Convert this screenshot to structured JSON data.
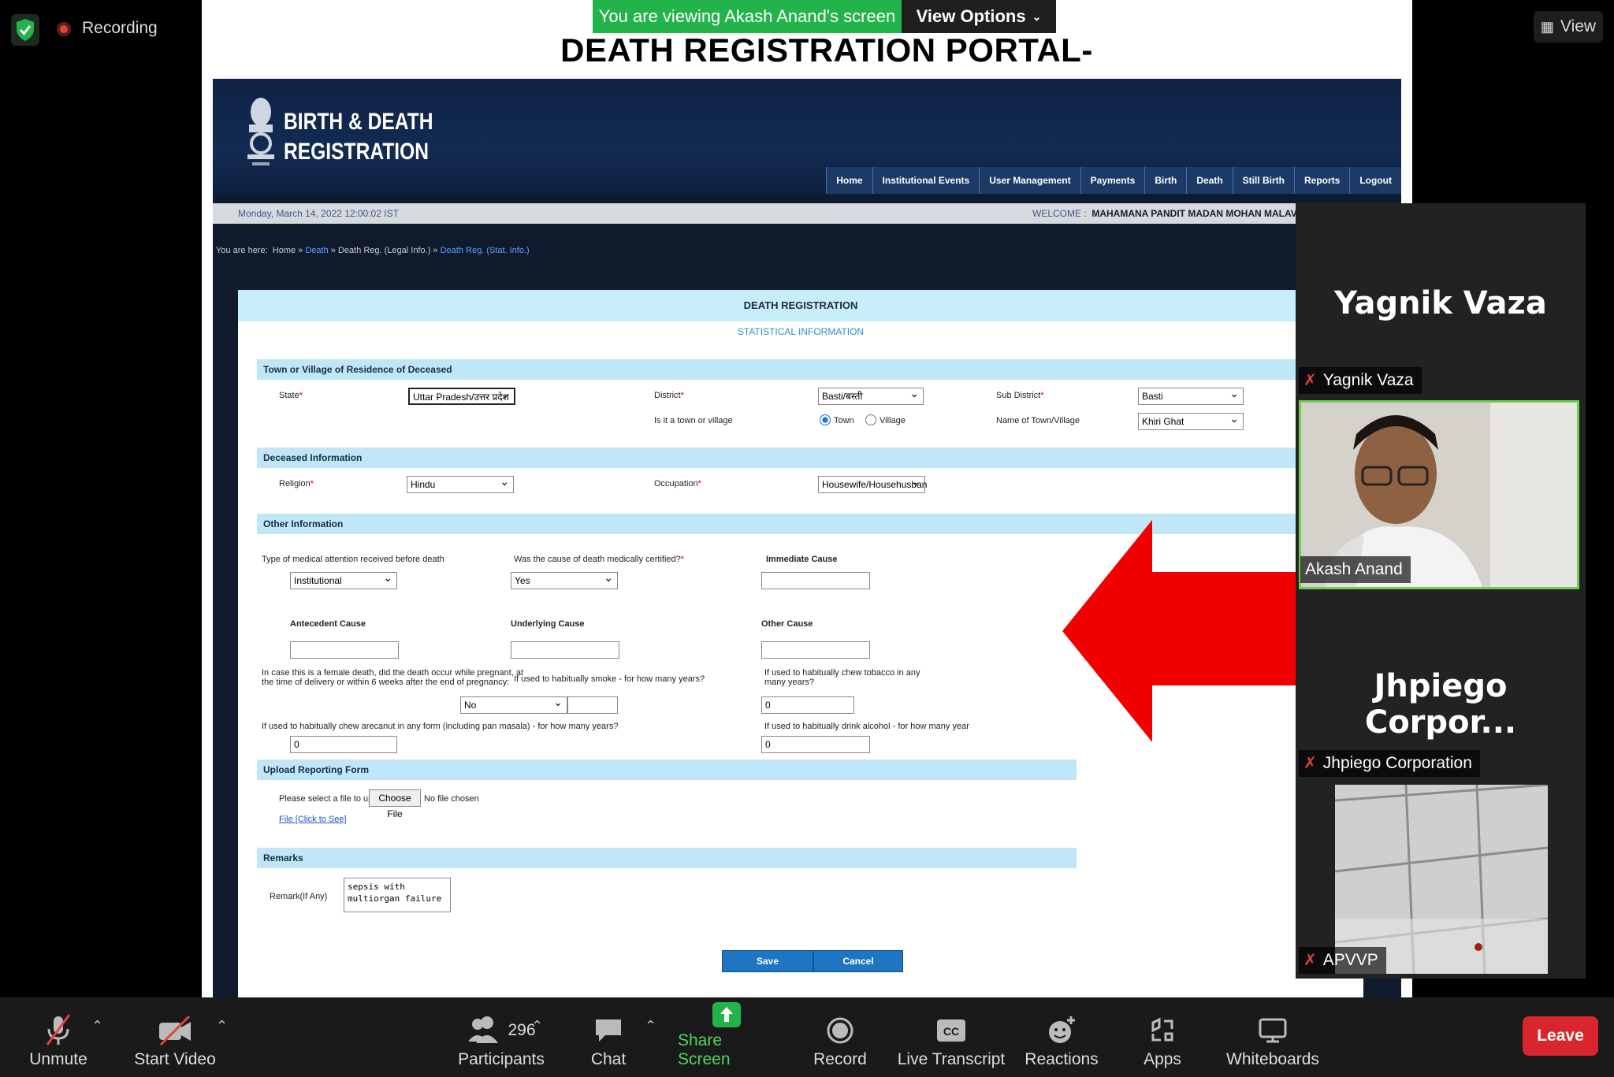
{
  "zoom": {
    "recording_label": "Recording",
    "view_label": "View",
    "viewing_banner": "You are viewing Akash Anand's screen",
    "view_options_label": "View Options",
    "toolbar": {
      "unmute": "Unmute",
      "start_video": "Start Video",
      "participants": "Participants",
      "participants_count": "296",
      "chat": "Chat",
      "share_screen": "Share Screen",
      "record": "Record",
      "live_transcript": "Live Transcript",
      "reactions": "Reactions",
      "apps": "Apps",
      "whiteboards": "Whiteboards",
      "leave": "Leave"
    },
    "panel": {
      "tile1_name": "Yagnik Vaza",
      "tile1_badge": "Yagnik Vaza",
      "tile2_badge": "Akash Anand",
      "tile3_name": "Jhpiego  Corpor...",
      "tile3_badge": "Jhpiego Corporation",
      "tile4_badge": "APVVP"
    }
  },
  "slide": {
    "title": "DEATH REGISTRATION PORTAL-"
  },
  "portal": {
    "logo_line1": "BIRTH & DEATH",
    "logo_line2": "REGISTRATION",
    "nav": [
      "Home",
      "Institutional Events",
      "User Management",
      "Payments",
      "Birth",
      "Death",
      "Still Birth",
      "Reports",
      "Logout"
    ],
    "date": "Monday, March 14, 2022 12:00:02 IST",
    "welcome_label": "WELCOME :",
    "welcome_name": "MAHAMANA PANDIT MADAN MOHAN MALAVIYA CANCER CE",
    "breadcrumb": {
      "prefix": "You are here:",
      "home": "Home",
      "death": "Death",
      "legal": "Death Reg. (Legal Info.)",
      "stat": "Death Reg. (Stat. Info.)"
    },
    "form_title": "DEATH REGISTRATION",
    "form_subtitle": "STATISTICAL INFORMATION",
    "sections": {
      "residence": "Town or Village of Residence of Deceased",
      "deceased": "Deceased Information",
      "other": "Other Information",
      "upload": "Upload Reporting Form",
      "remarks": "Remarks"
    },
    "fields": {
      "state_label": "State",
      "state_value": "Uttar Pradesh/उत्तर प्रदेश",
      "district_label": "District",
      "district_value": "Basti/बस्ती",
      "subdistrict_label": "Sub District",
      "subdistrict_value": "Basti",
      "town_or_village_label": "Is it a town or village",
      "town_option": "Town",
      "village_option": "Village",
      "town_name_label": "Name of Town/Village",
      "town_name_value": "Khiri Ghat",
      "religion_label": "Religion",
      "religion_value": "Hindu",
      "occupation_label": "Occupation",
      "occupation_value": "Housewife/Househusban",
      "medical_attention_label": "Type of medical attention received before death",
      "medical_attention_value": "Institutional",
      "certified_label": "Was the cause of death medically certified?",
      "certified_value": "Yes",
      "immediate_cause_label": "Immediate Cause",
      "antecedent_cause_label": "Antecedent Cause",
      "underlying_cause_label": "Underlying Cause",
      "other_cause_label": "Other Cause",
      "female_death_label_1": "In case this is a female death, did the death occur while pregnant, at",
      "female_death_label_2": "the time of delivery or within 6 weeks after the end of pregnancy:",
      "female_death_value": "No",
      "smoke_label": "If used to habitually smoke - for how many years?",
      "tobacco_label_1": "If used to habitually chew tobacco in any",
      "tobacco_label_2": "many years?",
      "tobacco_value": "0",
      "arecanut_label": "If used to habitually chew arecanut in any form (including pan masala) - for how many years?",
      "arecanut_value": "0",
      "alcohol_label": "If used to habitually drink alcohol - for how many year",
      "alcohol_value": "0",
      "upload_label": "Please select a file to upload",
      "choose_file": "Choose File",
      "no_file": "No file chosen",
      "file_link": "File [Click to See]",
      "remark_label": "Remark(If Any)",
      "remark_value": "sepsis with\nmultiorgan failure",
      "save": "Save",
      "cancel": "Cancel"
    }
  }
}
